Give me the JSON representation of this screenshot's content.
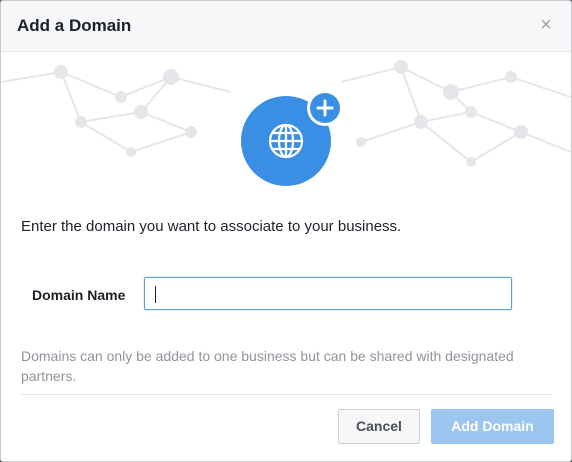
{
  "dialog": {
    "title": "Add a Domain",
    "close_glyph": "×"
  },
  "hero": {
    "icon": "globe-icon",
    "badge_icon": "plus-icon",
    "accent_color": "#3a8ee4"
  },
  "form": {
    "prompt": "Enter the domain you want to associate to your business.",
    "field_label": "Domain Name",
    "field_value": "",
    "help_text": "Domains can only be added to one business but can be shared with designated partners."
  },
  "footer": {
    "cancel_label": "Cancel",
    "add_label": "Add Domain",
    "add_color": "#9cc6f0"
  }
}
